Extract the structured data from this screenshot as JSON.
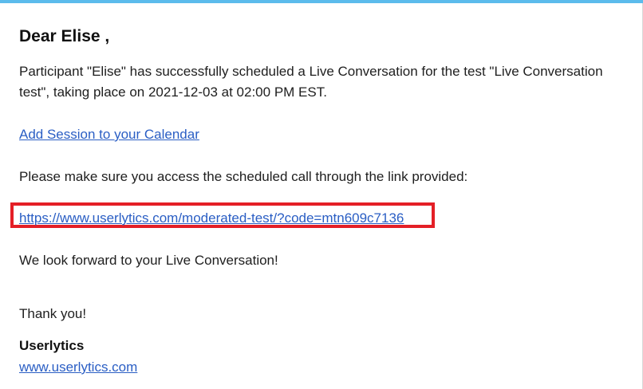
{
  "email": {
    "greeting": "Dear Elise ,",
    "intro": "Participant \"Elise\" has successfully scheduled a Live Conversation for the test \"Live Conversation test\", taking place on 2021-12-03 at 02:00 PM EST.",
    "calendar_link": "Add Session to your Calendar",
    "access_text": "Please make sure you access the scheduled call through the link provided:",
    "call_link": "https://www.userlytics.com/moderated-test/?code=mtn609c7136",
    "forward_text": "We look forward to your Live Conversation!",
    "thanks_text": "Thank you!",
    "company_name": "Userlytics",
    "company_site": "www.userlytics.com"
  },
  "colors": {
    "accent_bar": "#5bbbec",
    "link": "#2a5ec4",
    "highlight": "#e41f26"
  }
}
